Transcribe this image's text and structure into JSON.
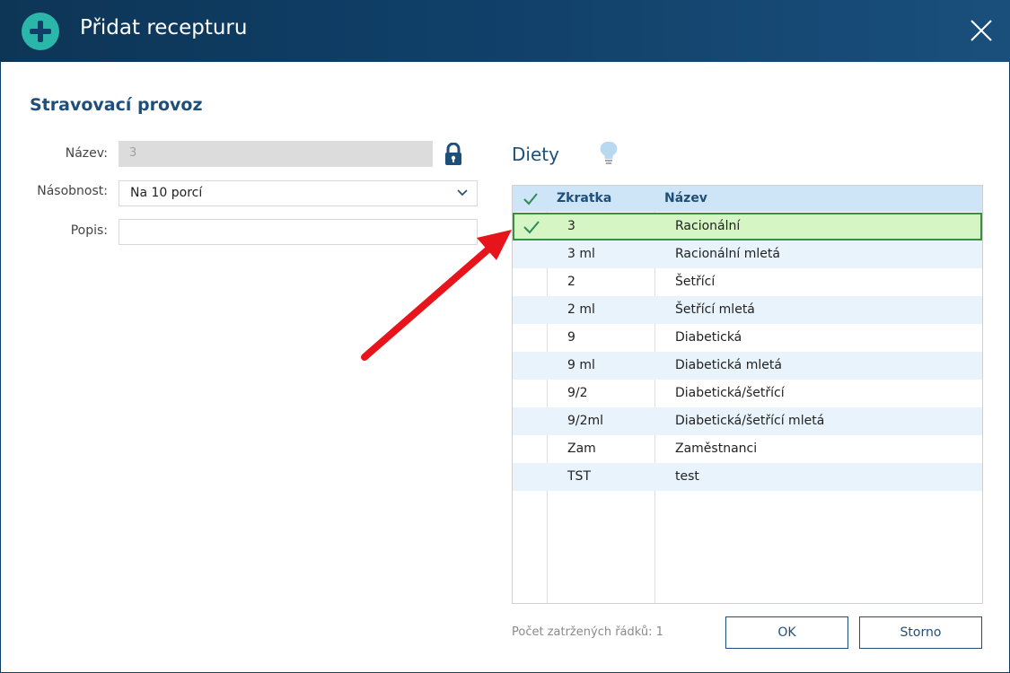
{
  "dialog": {
    "title": "Přidat recepturu"
  },
  "section_title": "Stravovací provoz",
  "form": {
    "nazev_label": "Název:",
    "nazev_value": "3",
    "nasobnost_label": "Násobnost:",
    "nasobnost_value": "Na 10 porcí",
    "popis_label": "Popis:",
    "popis_value": ""
  },
  "diety": {
    "title": "Diety",
    "columns": {
      "abbr": "Zkratka",
      "name": "Název"
    },
    "rows": [
      {
        "abbr": "3",
        "name": "Racionální",
        "checked": true
      },
      {
        "abbr": "3 ml",
        "name": "Racionální mletá",
        "checked": false
      },
      {
        "abbr": "2",
        "name": "Šetřící",
        "checked": false
      },
      {
        "abbr": "2 ml",
        "name": "Šetřící mletá",
        "checked": false
      },
      {
        "abbr": "9",
        "name": "Diabetická",
        "checked": false
      },
      {
        "abbr": "9 ml",
        "name": "Diabetická mletá",
        "checked": false
      },
      {
        "abbr": "9/2",
        "name": "Diabetická/šetřící",
        "checked": false
      },
      {
        "abbr": "9/2ml",
        "name": "Diabetická/šetřící mletá",
        "checked": false
      },
      {
        "abbr": "Zam",
        "name": "Zaměstnanci",
        "checked": false
      },
      {
        "abbr": "TST",
        "name": "test",
        "checked": false
      }
    ]
  },
  "footer": {
    "count_text": "Počet zatržených řádků: 1",
    "ok_label": "OK",
    "storno_label": "Storno"
  },
  "colors": {
    "titlebar": "#0f3e66",
    "accent": "#1e4f7a",
    "plus_icon": "#2ab7a9",
    "selected_row": "#d5f5c4",
    "selected_border": "#3a8f3a",
    "check": "#2e8b57",
    "arrow": "#e8141b"
  },
  "icons": {
    "add": "plus-circle-icon",
    "close": "close-icon",
    "lock": "lock-icon",
    "dropdown": "chevron-down-icon",
    "hint": "lightbulb-icon",
    "check": "checkmark-icon"
  }
}
